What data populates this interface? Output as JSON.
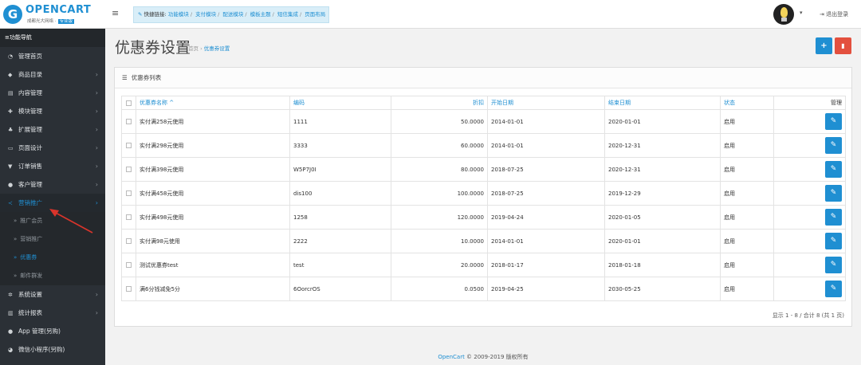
{
  "logo": {
    "name": "OPENCART",
    "sub": "成都光大网络 ·",
    "badge": "专业版"
  },
  "topbar": {
    "quick_label": "快捷链接:",
    "quick_links": [
      "功能模块",
      "支付模块",
      "配送模块",
      "模板主题",
      "短信集成",
      "页面布局"
    ],
    "logout": "退出登录"
  },
  "sidebar": {
    "header": "功能导航",
    "items": [
      {
        "label": "管理首页",
        "icon": "dashboard-icon",
        "chev": ""
      },
      {
        "label": "商品目录",
        "icon": "tag-icon",
        "chev": "›"
      },
      {
        "label": "内容管理",
        "icon": "book-icon",
        "chev": "›"
      },
      {
        "label": "模块管理",
        "icon": "puzzle-icon",
        "chev": "›"
      },
      {
        "label": "扩展管理",
        "icon": "sitemap-icon",
        "chev": "›"
      },
      {
        "label": "页面设计",
        "icon": "monitor-icon",
        "chev": "›"
      },
      {
        "label": "订单销售",
        "icon": "cart-icon",
        "chev": "›"
      },
      {
        "label": "客户管理",
        "icon": "user-icon",
        "chev": "›"
      }
    ],
    "marketing": {
      "label": "营销推广",
      "chev": "›"
    },
    "marketing_sub": [
      "推广会员",
      "营销推广",
      "优惠券",
      "邮件群发"
    ],
    "bottom_items": [
      {
        "label": "系统设置",
        "icon": "gear-icon",
        "chev": "›"
      },
      {
        "label": "统计报表",
        "icon": "bar-chart-icon",
        "chev": "›"
      },
      {
        "label": "App 管理(另购)",
        "icon": "apple-icon",
        "chev": ""
      },
      {
        "label": "微信小程序(另购)",
        "icon": "wechat-icon",
        "chev": ""
      }
    ]
  },
  "page": {
    "title": "优惠券设置",
    "breadcrumb_home": "首页",
    "breadcrumb_sep": "›",
    "breadcrumb_current": "优惠券设置"
  },
  "panel": {
    "title": "优惠券列表"
  },
  "table": {
    "headers": {
      "name": "优惠券名称 ^",
      "code": "编码",
      "discount": "折扣",
      "start": "开始日期",
      "end": "结束日期",
      "status": "状态",
      "manage": "管理"
    },
    "rows": [
      {
        "name": "实付满258元使用",
        "code": "1111",
        "discount": "50.0000",
        "start": "2014-01-01",
        "end": "2020-01-01",
        "status": "启用"
      },
      {
        "name": "实付满298元使用",
        "code": "3333",
        "discount": "60.0000",
        "start": "2014-01-01",
        "end": "2020-12-31",
        "status": "启用"
      },
      {
        "name": "实付满398元使用",
        "code": "W5P7J0I",
        "discount": "80.0000",
        "start": "2018-07-25",
        "end": "2020-12-31",
        "status": "启用"
      },
      {
        "name": "实付满458元使用",
        "code": "dis100",
        "discount": "100.0000",
        "start": "2018-07-25",
        "end": "2019-12-29",
        "status": "启用"
      },
      {
        "name": "实付满498元使用",
        "code": "1258",
        "discount": "120.0000",
        "start": "2019-04-24",
        "end": "2020-01-05",
        "status": "启用"
      },
      {
        "name": "实付满98元使用",
        "code": "2222",
        "discount": "10.0000",
        "start": "2014-01-01",
        "end": "2020-01-01",
        "status": "启用"
      },
      {
        "name": "测试优惠券test",
        "code": "test",
        "discount": "20.0000",
        "start": "2018-01-17",
        "end": "2018-01-18",
        "status": "启用"
      },
      {
        "name": "满6分钱减免5分",
        "code": "6OorcrOS",
        "discount": "0.0500",
        "start": "2019-04-25",
        "end": "2030-05-25",
        "status": "启用"
      }
    ]
  },
  "pager": "显示 1 - 8 / 合计 8 (共 1 页)",
  "footer": {
    "brand": "OpenCart",
    "text": " © 2009-2019 版权所有"
  },
  "colors": {
    "accent": "#1f8fd2",
    "danger": "#e3503e",
    "sidebar": "#2b3036"
  }
}
